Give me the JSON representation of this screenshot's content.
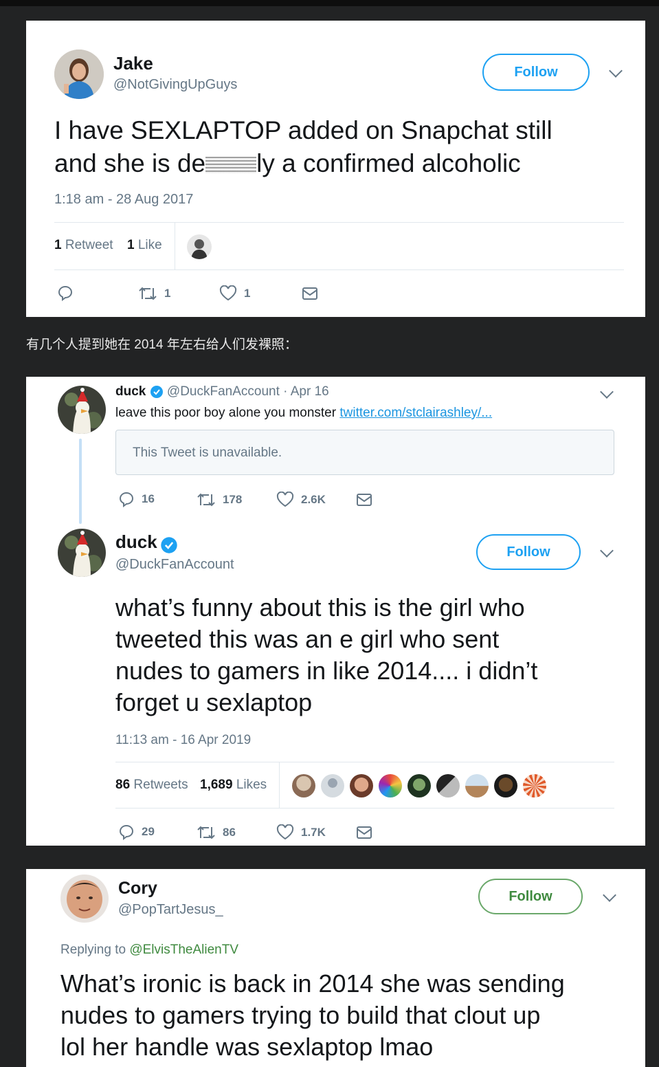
{
  "caption": "有几个人提到她在 2014 年左右给人们发裸照：",
  "tweet1": {
    "name": "Jake",
    "handle": "@NotGivingUpGuys",
    "follow_label": "Follow",
    "text_line1": "I have SEXLAPTOP added on Snapchat still",
    "text_line2_a": "and she is de",
    "text_line2_b": "ly a confirmed alcoholic",
    "timestamp": "1:18 am - 28 Aug 2017",
    "retweets_count": "1",
    "retweets_label": "Retweet",
    "likes_count": "1",
    "likes_label": "Like",
    "actions": {
      "reply": "",
      "retweet": "1",
      "like": "1"
    }
  },
  "tweet2": {
    "parent": {
      "name": "duck",
      "handle": "@DuckFanAccount",
      "date": "· Apr 16",
      "text": "leave this poor boy alone you monster",
      "link": "twitter.com/stclairashley/...",
      "quote_text": "This Tweet is unavailable.",
      "actions": {
        "reply": "16",
        "retweet": "178",
        "like": "2.6K"
      }
    },
    "main": {
      "name": "duck",
      "handle": "@DuckFanAccount",
      "follow_label": "Follow",
      "lines": [
        "what’s funny about this is the girl who",
        "tweeted this was an e girl who sent",
        "nudes to gamers in like 2014.... i didn’t",
        "forget u sexlaptop"
      ],
      "timestamp": "11:13 am - 16 Apr 2019",
      "retweets_count": "86",
      "retweets_label": "Retweets",
      "likes_count": "1,689",
      "likes_label": "Likes",
      "actions": {
        "reply": "29",
        "retweet": "86",
        "like": "1.7K"
      }
    }
  },
  "tweet3": {
    "name": "Cory",
    "handle": "@PopTartJesus_",
    "follow_label": "Follow",
    "replying_label": "Replying to",
    "replying_to": "@ElvisTheAlienTV",
    "lines": [
      "What’s ironic is back in 2014 she was sending",
      "nudes to gamers trying to build that clout up",
      "lol her handle was sexlaptop lmao"
    ]
  },
  "colors": {
    "accent": "#1da1f2",
    "follow_green": "#3f8a3f",
    "verified": "#1da1f2"
  }
}
